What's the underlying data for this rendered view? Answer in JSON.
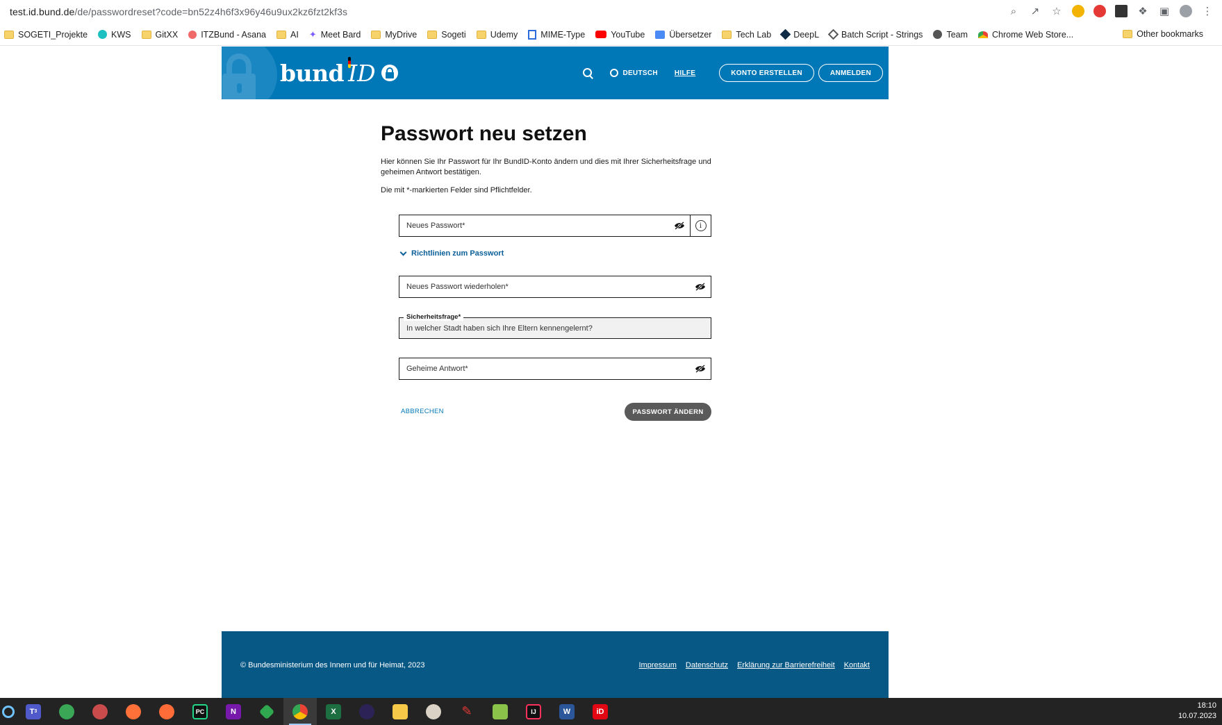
{
  "browser": {
    "url_host": "test.id.bund.de",
    "url_path": "/de/passwordreset?code=bn52z4h6f3x96y46u9ux2kz6fzt2kf3s",
    "bookmarks": [
      {
        "label": "SOGETI_Projekte",
        "icon": "folder-icon"
      },
      {
        "label": "KWS",
        "icon": "kws-icon"
      },
      {
        "label": "GitXX",
        "icon": "folder-icon"
      },
      {
        "label": "ITZBund - Asana",
        "icon": "asana-icon"
      },
      {
        "label": "AI",
        "icon": "folder-icon"
      },
      {
        "label": "Meet Bard",
        "icon": "bard-icon"
      },
      {
        "label": "MyDrive",
        "icon": "folder-icon"
      },
      {
        "label": "Sogeti",
        "icon": "folder-icon"
      },
      {
        "label": "Udemy",
        "icon": "folder-icon"
      },
      {
        "label": "MIME-Type",
        "icon": "mime-icon"
      },
      {
        "label": "YouTube",
        "icon": "youtube-icon"
      },
      {
        "label": "Übersetzer",
        "icon": "translate-icon"
      },
      {
        "label": "Tech Lab",
        "icon": "folder-icon"
      },
      {
        "label": "DeepL",
        "icon": "deepl-icon"
      },
      {
        "label": "Batch Script - Strings",
        "icon": "batch-icon"
      },
      {
        "label": "Team",
        "icon": "globe-icon"
      },
      {
        "label": "Chrome Web Store...",
        "icon": "webstore-icon"
      }
    ],
    "other_bookmarks": "Other bookmarks"
  },
  "header": {
    "logo_bund": "bund",
    "logo_id": "ID",
    "language": "DEUTSCH",
    "help": "HILFE",
    "create_account": "KONTO ERSTELLEN",
    "login": "ANMELDEN"
  },
  "main": {
    "title": "Passwort neu setzen",
    "description": "Hier können Sie Ihr Passwort für Ihr BundID-Konto ändern und dies mit Ihrer Sicherheitsfrage und geheimen Antwort bestätigen.",
    "required_note": "Die mit *-markierten Felder sind Pflichtfelder.",
    "new_password_placeholder": "Neues Passwort*",
    "guidelines": "Richtlinien zum Passwort",
    "repeat_password_placeholder": "Neues Passwort wiederholen*",
    "security_question_label": "Sicherheitsfrage*",
    "security_question_value": "In welcher Stadt haben sich Ihre Eltern kennengelernt?",
    "secret_answer_placeholder": "Geheime Antwort*",
    "cancel": "ABBRECHEN",
    "submit": "PASSWORT ÄNDERN"
  },
  "footer": {
    "copyright": "© Bundesministerium des Innern und für Heimat, 2023",
    "links": [
      "Impressum",
      "Datenschutz",
      "Erklärung zur Barrierefreiheit",
      "Kontakt"
    ]
  },
  "taskbar": {
    "time": "18:10",
    "date": "10.07.2023",
    "teams_badge": "3"
  },
  "colors": {
    "brand_blue": "#0077b6",
    "footer_blue": "#085885",
    "submit_gray": "#5a5a5a"
  }
}
